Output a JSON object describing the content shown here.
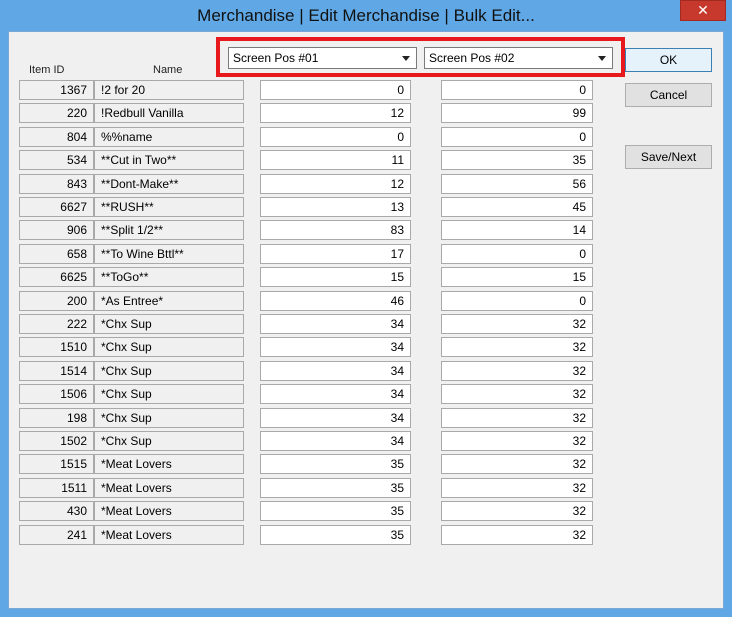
{
  "window": {
    "title": "Merchandise | Edit Merchandise | Bulk Edit...",
    "close_symbol": "✕"
  },
  "columns": {
    "item_id": "Item ID",
    "name": "Name"
  },
  "selects": {
    "first": "Screen Pos #01",
    "second": "Screen Pos #02"
  },
  "buttons": {
    "ok": "OK",
    "cancel": "Cancel",
    "save_next": "Save/Next"
  },
  "rows": [
    {
      "id": "1367",
      "name": "!2 for 20",
      "pos1": "0",
      "pos2": "0"
    },
    {
      "id": "220",
      "name": "!Redbull Vanilla",
      "pos1": "12",
      "pos2": "99"
    },
    {
      "id": "804",
      "name": "%%name",
      "pos1": "0",
      "pos2": "0"
    },
    {
      "id": "534",
      "name": "**Cut in Two**",
      "pos1": "11",
      "pos2": "35"
    },
    {
      "id": "843",
      "name": "**Dont-Make**",
      "pos1": "12",
      "pos2": "56"
    },
    {
      "id": "6627",
      "name": "**RUSH**",
      "pos1": "13",
      "pos2": "45"
    },
    {
      "id": "906",
      "name": "**Split 1/2**",
      "pos1": "83",
      "pos2": "14"
    },
    {
      "id": "658",
      "name": "**To Wine Bttl**",
      "pos1": "17",
      "pos2": "0"
    },
    {
      "id": "6625",
      "name": "**ToGo**",
      "pos1": "15",
      "pos2": "15"
    },
    {
      "id": "200",
      "name": "*As Entree*",
      "pos1": "46",
      "pos2": "0"
    },
    {
      "id": "222",
      "name": "*Chx Sup",
      "pos1": "34",
      "pos2": "32"
    },
    {
      "id": "1510",
      "name": "*Chx Sup",
      "pos1": "34",
      "pos2": "32"
    },
    {
      "id": "1514",
      "name": "*Chx Sup",
      "pos1": "34",
      "pos2": "32"
    },
    {
      "id": "1506",
      "name": "*Chx Sup",
      "pos1": "34",
      "pos2": "32"
    },
    {
      "id": "198",
      "name": "*Chx Sup",
      "pos1": "34",
      "pos2": "32"
    },
    {
      "id": "1502",
      "name": "*Chx Sup",
      "pos1": "34",
      "pos2": "32"
    },
    {
      "id": "1515",
      "name": "*Meat Lovers",
      "pos1": "35",
      "pos2": "32"
    },
    {
      "id": "1511",
      "name": "*Meat Lovers",
      "pos1": "35",
      "pos2": "32"
    },
    {
      "id": "430",
      "name": "*Meat Lovers",
      "pos1": "35",
      "pos2": "32"
    },
    {
      "id": "241",
      "name": "*Meat Lovers",
      "pos1": "35",
      "pos2": "32"
    }
  ]
}
